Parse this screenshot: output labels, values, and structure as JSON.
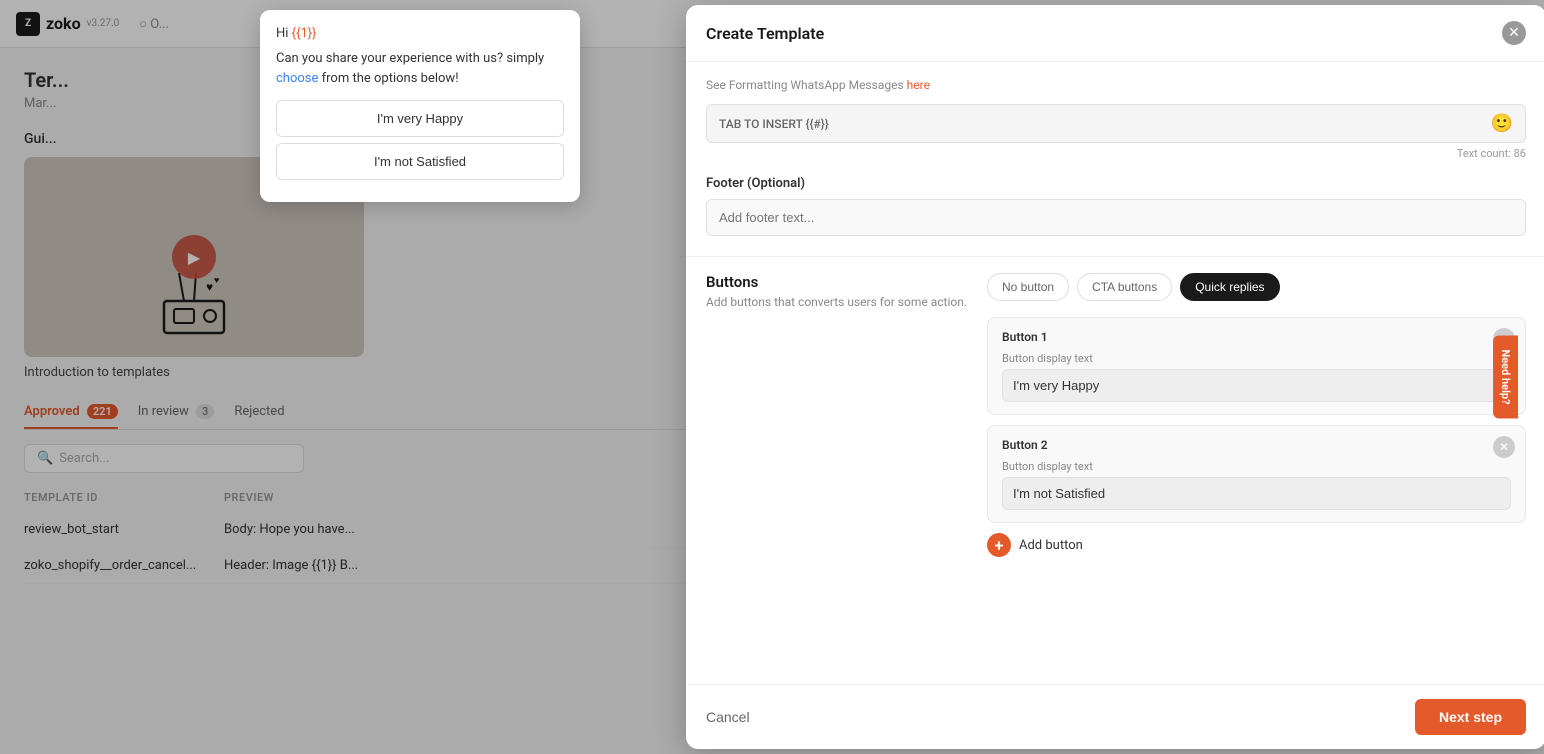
{
  "app": {
    "logo_text": "zoko",
    "version": "v3.27.0"
  },
  "bg": {
    "title": "Ter...",
    "subtitle": "Mar...",
    "guide_label": "Gui...",
    "intro_label": "Introduction to templates",
    "tabs": [
      {
        "label": "Approved",
        "badge": "221",
        "active": true
      },
      {
        "label": "In review",
        "badge": "3",
        "active": false
      },
      {
        "label": "Rejected",
        "badge": "",
        "active": false
      }
    ],
    "search_placeholder": "Search...",
    "table_headers": [
      "TEMPLATE ID",
      "PREVIEW"
    ],
    "rows": [
      {
        "id": "review_bot_start",
        "preview": "Body: Hope you have..."
      },
      {
        "id": "zoko_shopify__order_cancel...",
        "preview": "Header: Image {{1}} B..."
      }
    ]
  },
  "nav": {
    "radio_buttons": "○ O..."
  },
  "preview_popup": {
    "greeting": "Hi {{1}}",
    "body": "Can you share your experience with us? simply choose from the options below!",
    "highlight_word": "choose",
    "btn1": "I'm very Happy",
    "btn2": "I'm not Satisfied"
  },
  "dialog": {
    "title": "Create Template",
    "format_note": "See Formatting WhatsApp Messages",
    "format_link_text": "here",
    "tab_insert_text": "TAB TO INSERT {{#}}",
    "text_count": "Text count: 86",
    "footer_section_label": "Footer (Optional)",
    "footer_placeholder": "Add footer text...",
    "buttons_section": {
      "title": "Buttons",
      "description": "Add buttons that converts users for some action.",
      "type_options": [
        "No button",
        "CTA buttons",
        "Quick replies"
      ],
      "active_type": "Quick replies",
      "button1": {
        "header": "Button 1",
        "display_label": "Button display text",
        "value": "I'm very Happy"
      },
      "button2": {
        "header": "Button 2",
        "display_label": "Button display text",
        "value": "I'm not Satisfied"
      },
      "add_button_label": "Add button"
    },
    "footer": {
      "cancel": "Cancel",
      "next": "Next step"
    },
    "need_help": "Need help?"
  }
}
